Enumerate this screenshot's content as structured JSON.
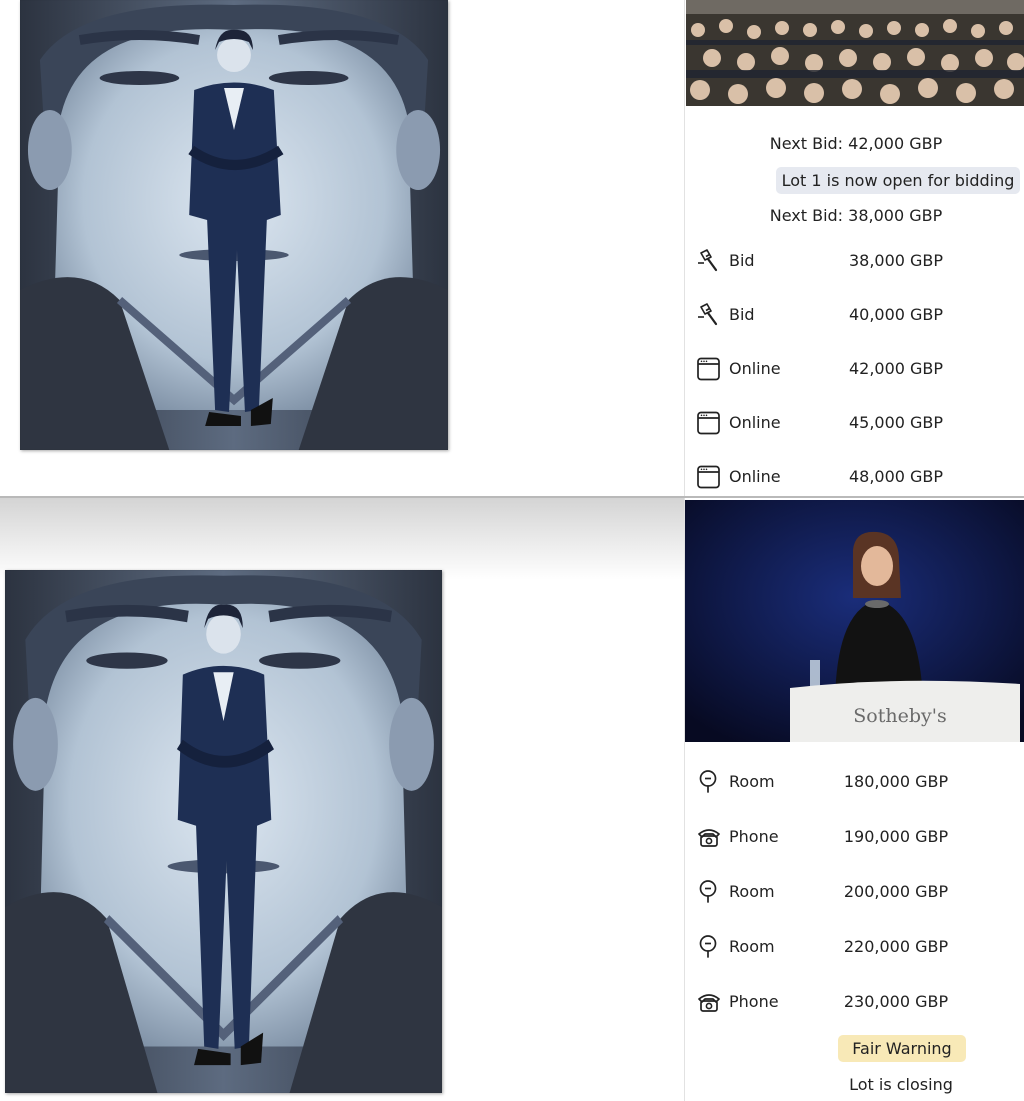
{
  "top_feed": {
    "next_bid_first": "Next Bid: 42,000 GBP",
    "lot_open_banner": "Lot 1 is now open for bidding",
    "next_bid_second": "Next Bid: 38,000 GBP",
    "bids": [
      {
        "icon": "gavel-icon",
        "source": "Bid",
        "amount": "38,000 GBP"
      },
      {
        "icon": "gavel-icon",
        "source": "Bid",
        "amount": "40,000 GBP"
      },
      {
        "icon": "browser-icon",
        "source": "Online",
        "amount": "42,000 GBP"
      },
      {
        "icon": "browser-icon",
        "source": "Online",
        "amount": "45,000 GBP"
      },
      {
        "icon": "browser-icon",
        "source": "Online",
        "amount": "48,000 GBP"
      }
    ]
  },
  "bottom_feed": {
    "podium_brand": "Sotheby's",
    "bids": [
      {
        "icon": "paddle-icon",
        "source": "Room",
        "amount": "180,000 GBP"
      },
      {
        "icon": "phone-icon",
        "source": "Phone",
        "amount": "190,000 GBP"
      },
      {
        "icon": "paddle-icon",
        "source": "Room",
        "amount": "200,000 GBP"
      },
      {
        "icon": "paddle-icon",
        "source": "Room",
        "amount": "220,000 GBP"
      },
      {
        "icon": "phone-icon",
        "source": "Phone",
        "amount": "230,000 GBP"
      }
    ],
    "fair_warning": "Fair Warning",
    "lot_closing": "Lot is closing"
  },
  "colors": {
    "banner_bg": "#e6e9f0",
    "warning_bg": "#f8e9b7",
    "painting_navy": "#1c2a4a",
    "painting_face": "#b8c8d8"
  }
}
